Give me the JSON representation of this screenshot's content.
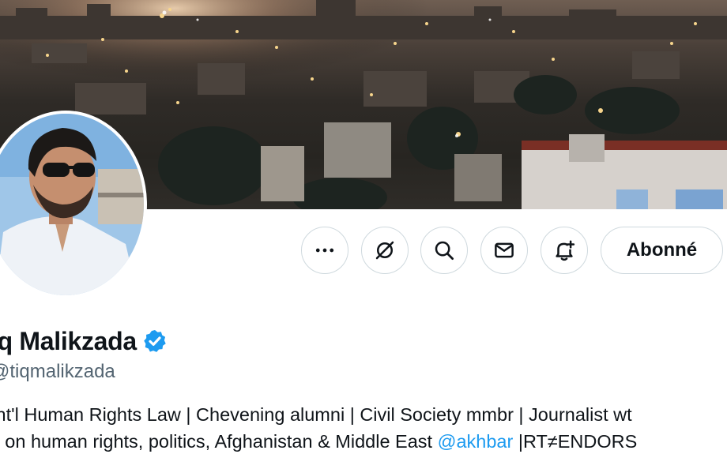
{
  "profile": {
    "display_name": "iq Malikzada",
    "handle": "tiqmalikzada",
    "verified_badge": "verified-checkmark",
    "bio": {
      "line1": "Int'l Human Rights Law | Chevening alumni | Civil Society mmbr | Journalist wt",
      "line2_before": "s on human rights, politics, Afghanistan & Middle East ",
      "line2_mention": "@akhbar",
      "line2_after": " |RT≠ENDORS"
    }
  },
  "actions": {
    "more_icon": "more-horizontal-icon",
    "grok_icon": "grok-icon",
    "search_icon": "search-icon",
    "message_icon": "mail-icon",
    "notify_icon": "bell-plus-icon",
    "follow_label": "Abonné"
  },
  "colors": {
    "text_primary": "#0f1419",
    "text_secondary": "#536471",
    "link": "#1d9bf0",
    "border": "#cfd9de",
    "verified": "#1d9bf0"
  }
}
